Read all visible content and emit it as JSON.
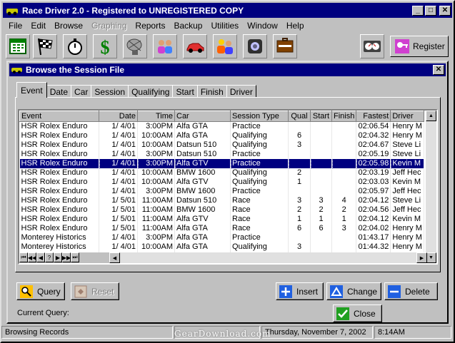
{
  "app": {
    "title": "Race Driver 2.0 - Registered to UNREGISTERED COPY",
    "minimize": "_",
    "maximize": "□",
    "close": "✕"
  },
  "menu": [
    "File",
    "Edit",
    "Browse",
    "Graphing",
    "Reports",
    "Backup",
    "Utilities",
    "Window",
    "Help"
  ],
  "menu_disabled": [
    "Graphing"
  ],
  "toolbar": {
    "icons": [
      "calendar-icon",
      "checkered-flag-icon",
      "stopwatch-icon",
      "dollar-icon",
      "satellite-dish-icon",
      "people-icon",
      "car-icon",
      "racers-icon",
      "tire-icon",
      "briefcase-icon",
      "speedometer-icon"
    ],
    "register_label": "Register"
  },
  "child": {
    "title": "Browse the Session File",
    "close": "✕"
  },
  "tabs": [
    "Event",
    "Date",
    "Car",
    "Session",
    "Qualifying",
    "Start",
    "Finish",
    "Driver"
  ],
  "active_tab": "Event",
  "grid": {
    "columns": [
      "Event",
      "Date",
      "Time",
      "Car",
      "Session Type",
      "Qual",
      "Start",
      "Finish",
      "Fastest",
      "Driver"
    ],
    "rows": [
      [
        "HSR Rolex Enduro",
        "1/ 4/01",
        "3:00PM",
        "Alfa GTA",
        "Practice",
        "",
        "",
        "",
        "02:06.54",
        "Henry M"
      ],
      [
        "HSR Rolex Enduro",
        "1/ 4/01",
        "10:00AM",
        "Alfa GTA",
        "Qualifying",
        "6",
        "",
        "",
        "02:04.32",
        "Henry M"
      ],
      [
        "HSR Rolex Enduro",
        "1/ 4/01",
        "10:00AM",
        "Datsun 510",
        "Qualifying",
        "3",
        "",
        "",
        "02:04.67",
        "Steve Li"
      ],
      [
        "HSR Rolex Enduro",
        "1/ 4/01",
        "3:00PM",
        "Datsun 510",
        "Practice",
        "",
        "",
        "",
        "02:05.19",
        "Steve Li"
      ],
      [
        "HSR Rolex Enduro",
        "1/ 4/01",
        "3:00PM",
        "Alfa GTV",
        "Practice",
        "",
        "",
        "",
        "02:05.98",
        "Kevin M"
      ],
      [
        "HSR Rolex Enduro",
        "1/ 4/01",
        "10:00AM",
        "BMW 1600",
        "Qualifying",
        "2",
        "",
        "",
        "02:03.19",
        "Jeff Hec"
      ],
      [
        "HSR Rolex Enduro",
        "1/ 4/01",
        "10:00AM",
        "Alfa GTV",
        "Qualifying",
        "1",
        "",
        "",
        "02:03.03",
        "Kevin M"
      ],
      [
        "HSR Rolex Enduro",
        "1/ 4/01",
        "3:00PM",
        "BMW 1600",
        "Practice",
        "",
        "",
        "",
        "02:05.97",
        "Jeff Hec"
      ],
      [
        "HSR Rolex Enduro",
        "1/ 5/01",
        "11:00AM",
        "Datsun 510",
        "Race",
        "3",
        "3",
        "4",
        "02:04.12",
        "Steve Li"
      ],
      [
        "HSR Rolex Enduro",
        "1/ 5/01",
        "11:00AM",
        "BMW 1600",
        "Race",
        "2",
        "2",
        "2",
        "02:04.56",
        "Jeff Hec"
      ],
      [
        "HSR Rolex Enduro",
        "1/ 5/01",
        "11:00AM",
        "Alfa GTV",
        "Race",
        "1",
        "1",
        "1",
        "02:04.12",
        "Kevin M"
      ],
      [
        "HSR Rolex Enduro",
        "1/ 5/01",
        "11:00AM",
        "Alfa GTA",
        "Race",
        "6",
        "6",
        "3",
        "02:04.02",
        "Henry M"
      ],
      [
        "Monterey Historics",
        "1/ 4/01",
        "3:00PM",
        "Alfa GTA",
        "Practice",
        "",
        "",
        "",
        "01:43.17",
        "Henry M"
      ],
      [
        "Monterey Historics",
        "1/ 4/01",
        "10:00AM",
        "Alfa GTA",
        "Qualifying",
        "3",
        "",
        "",
        "01:44.32",
        "Henry M"
      ],
      [
        "Monterey Historics",
        "1/ 4/01",
        "10:00AM",
        "Datsun 510",
        "Qualifying",
        "2",
        "",
        "",
        "01:42.11",
        "Steve Li"
      ]
    ],
    "selected_row": 4,
    "nav": [
      "⏮",
      "◀◀",
      "◀",
      "?",
      "▶",
      "▶▶",
      "⏭"
    ]
  },
  "buttons": {
    "query": "Query",
    "reset": "Reset",
    "insert": "Insert",
    "change": "Change",
    "delete": "Delete",
    "close": "Close"
  },
  "current_query_label": "Current Query:",
  "status": {
    "left": "Browsing Records",
    "date": "Thursday, November  7, 2002",
    "time": "8:14AM"
  },
  "watermark": "GearDownload.com"
}
